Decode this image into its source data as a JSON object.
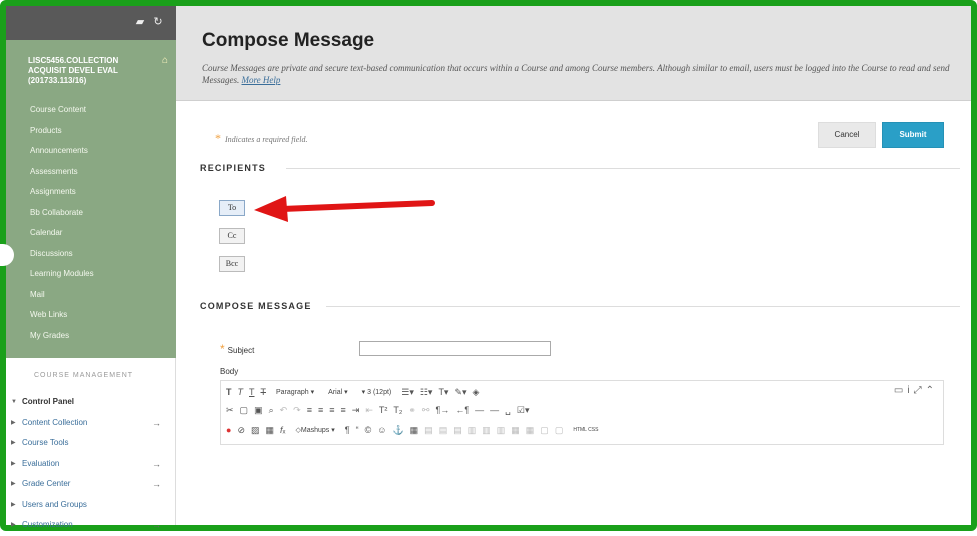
{
  "sidebar": {
    "course_title": "LISC5456.COLLECTION ACQUISIT DEVEL EVAL (201733.113/16)",
    "items": [
      {
        "label": "Course Content"
      },
      {
        "label": "Products"
      },
      {
        "label": "Announcements"
      },
      {
        "label": "Assessments"
      },
      {
        "label": "Assignments"
      },
      {
        "label": "Bb Collaborate"
      },
      {
        "label": "Calendar"
      },
      {
        "label": "Discussions"
      },
      {
        "label": "Learning Modules"
      },
      {
        "label": "Mail"
      },
      {
        "label": "Web Links"
      },
      {
        "label": "My Grades"
      }
    ],
    "management_heading": "COURSE MANAGEMENT",
    "management_items": [
      {
        "label": "Control Panel"
      },
      {
        "label": "Content Collection"
      },
      {
        "label": "Course Tools"
      },
      {
        "label": "Evaluation"
      },
      {
        "label": "Grade Center"
      },
      {
        "label": "Users and Groups"
      },
      {
        "label": "Customization"
      }
    ]
  },
  "header": {
    "title": "Compose Message",
    "description": "Course Messages are private and secure text-based communication that occurs within a Course and among Course members. Although similar to email, users must be logged into the Course to read and send Messages.",
    "help_link": "More Help"
  },
  "form": {
    "required_note": "Indicates a required field.",
    "required_star": "*",
    "cancel_label": "Cancel",
    "submit_label": "Submit",
    "recipients_title": "RECIPIENTS",
    "to_label": "To",
    "cc_label": "Cc",
    "bcc_label": "Bcc",
    "compose_title": "COMPOSE MESSAGE",
    "subject_label": "Subject",
    "subject_value": "",
    "body_label": "Body"
  },
  "editor": {
    "paragraph_select": "Paragraph",
    "font_select": "Arial",
    "size_select": "3 (12pt)",
    "mashups_label": "Mashups",
    "html_label": "HTML CSS"
  },
  "colors": {
    "frame_border": "#1aa01a",
    "sidebar_bg": "#8aa883",
    "submit_bg": "#2a9fc7",
    "arrow": "#e01515",
    "required_star": "#f0a040"
  }
}
